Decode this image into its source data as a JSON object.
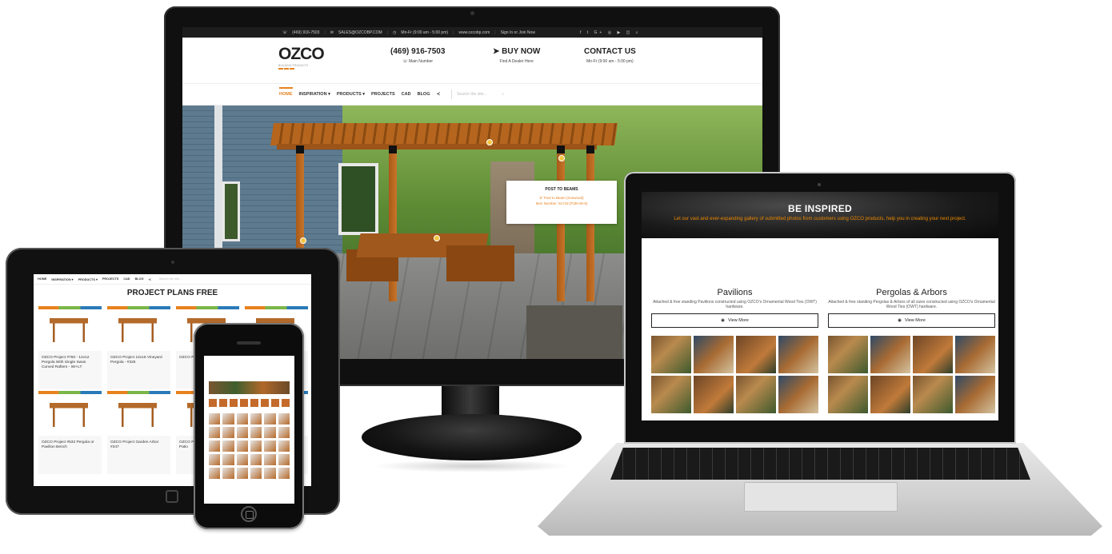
{
  "desktop": {
    "topbar": {
      "phone": "(469) 916-7503",
      "email": "SALES@OZCOBP.COM",
      "hours": "Mn-Fr (9:00 am - 5:00 pm)",
      "site": "www.ozcobp.com",
      "signin": "Sign In or Join Now"
    },
    "logo": {
      "wordmark": "OZCO",
      "tagline": "BUILDING PRODUCTS"
    },
    "header": {
      "phone_big": "(469) 916-7503",
      "phone_small": "Main Number",
      "buy_big": "BUY NOW",
      "buy_small": "Find A Dealer Here",
      "contact_big": "CONTACT US",
      "contact_small": "Mn-Fr (9:00 am - 5:00 pm)"
    },
    "nav": [
      {
        "label": "HOME"
      },
      {
        "label": "INSPIRATION"
      },
      {
        "label": "PRODUCTS"
      },
      {
        "label": "PROJECTS"
      },
      {
        "label": "CAD"
      },
      {
        "label": "BLOG"
      }
    ],
    "search_placeholder": "Search the site...",
    "tooltip": {
      "title": "POST TO BEAMS",
      "line1": "6\" Post to Beam (Ironwood)",
      "line2": "Item Number: 51718 (P2B-IW-6)"
    }
  },
  "laptop": {
    "banner_title": "BE INSPIRED",
    "banner_subtitle": "Let our vast and ever-expanding gallery of submitted photos from customers using OZCO products, help you in creating your next project.",
    "columns": [
      {
        "title": "Pavilions",
        "desc": "Attached & free standing Pavilions constructed using OZCO's Ornamental Wood Ties (OWT) hardware.",
        "button": "View More"
      },
      {
        "title": "Pergolas & Arbors",
        "desc": "Attached & free standing Pergolas & Arbors of all sizes constructed using OZCO's Ornamental Wood Ties (OWT) hardware.",
        "button": "View More"
      }
    ]
  },
  "tablet": {
    "nav": [
      "HOME",
      "INSPIRATION",
      "PRODUCTS",
      "PROJECTS",
      "CAD",
      "BLOG"
    ],
    "search_placeholder": "Search the site...",
    "title": "PROJECT PLANS FREE",
    "cards": [
      {
        "caption": "OZCO Project #760 - 12x12 Pergola With Single Swan Curved Rafters - IW+LT"
      },
      {
        "caption": "OZCO Project 12x16 Vineyard Pergola - #325"
      },
      {
        "caption": "OZCO Project Porch"
      },
      {
        "caption": ""
      },
      {
        "caption": "OZCO Project #532 Pergola or Pavilion Bench"
      },
      {
        "caption": "OZCO Project Garden Arbor #347"
      },
      {
        "caption": "OZCO Project 12x12 Pergola Patio"
      },
      {
        "caption": ""
      }
    ]
  }
}
